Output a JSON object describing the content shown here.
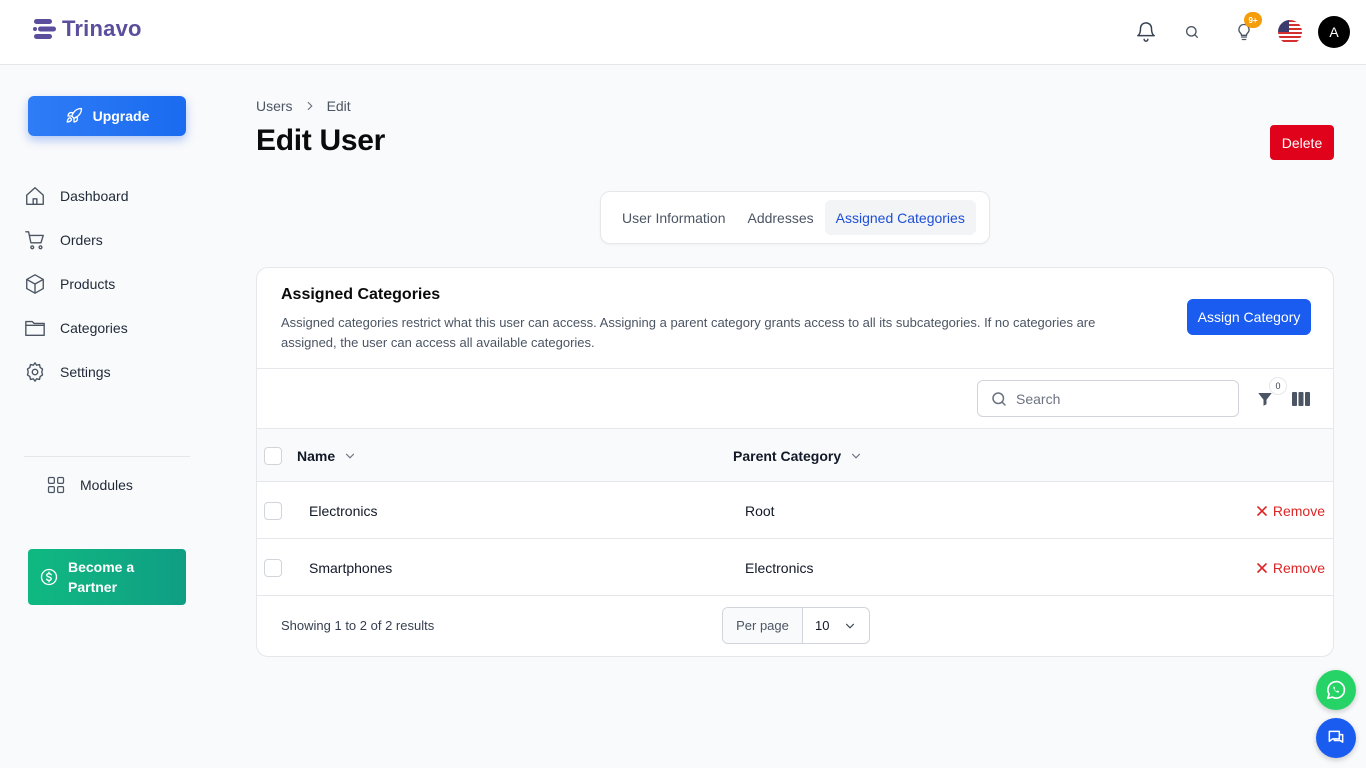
{
  "app": {
    "name": "Trinavo"
  },
  "topbar": {
    "notification_badge": "9+",
    "avatar_initial": "A"
  },
  "sidebar": {
    "upgrade_label": "Upgrade",
    "items": [
      {
        "label": "Dashboard",
        "icon": "home-icon"
      },
      {
        "label": "Orders",
        "icon": "cart-icon"
      },
      {
        "label": "Products",
        "icon": "box-icon"
      },
      {
        "label": "Categories",
        "icon": "folder-icon"
      },
      {
        "label": "Settings",
        "icon": "gear-icon"
      }
    ],
    "modules_label": "Modules",
    "partner_label_line1": "Become a",
    "partner_label_line2": "Partner"
  },
  "breadcrumb": {
    "parent": "Users",
    "current": "Edit"
  },
  "page": {
    "title": "Edit User",
    "delete_label": "Delete"
  },
  "tabs": [
    {
      "label": "User Information",
      "active": false
    },
    {
      "label": "Addresses",
      "active": false
    },
    {
      "label": "Assigned Categories",
      "active": true
    }
  ],
  "card": {
    "title": "Assigned Categories",
    "description": "Assigned categories restrict what this user can access. Assigning a parent category grants access to all its subcategories. If no categories are assigned, the user can access all available categories.",
    "assign_label": "Assign Category"
  },
  "table": {
    "search_placeholder": "Search",
    "filter_count": "0",
    "columns": [
      "Name",
      "Parent Category"
    ],
    "rows": [
      {
        "name": "Electronics",
        "parent": "Root",
        "action": "Remove"
      },
      {
        "name": "Smartphones",
        "parent": "Electronics",
        "action": "Remove"
      }
    ],
    "showing": "Showing 1 to 2 of 2 results",
    "per_page_label": "Per page",
    "per_page_value": "10"
  },
  "colors": {
    "primary": "#1a5cf0",
    "danger": "#e0021b",
    "brand": "#5b4e9c",
    "partner": "#10b981",
    "whatsapp": "#25d366"
  }
}
